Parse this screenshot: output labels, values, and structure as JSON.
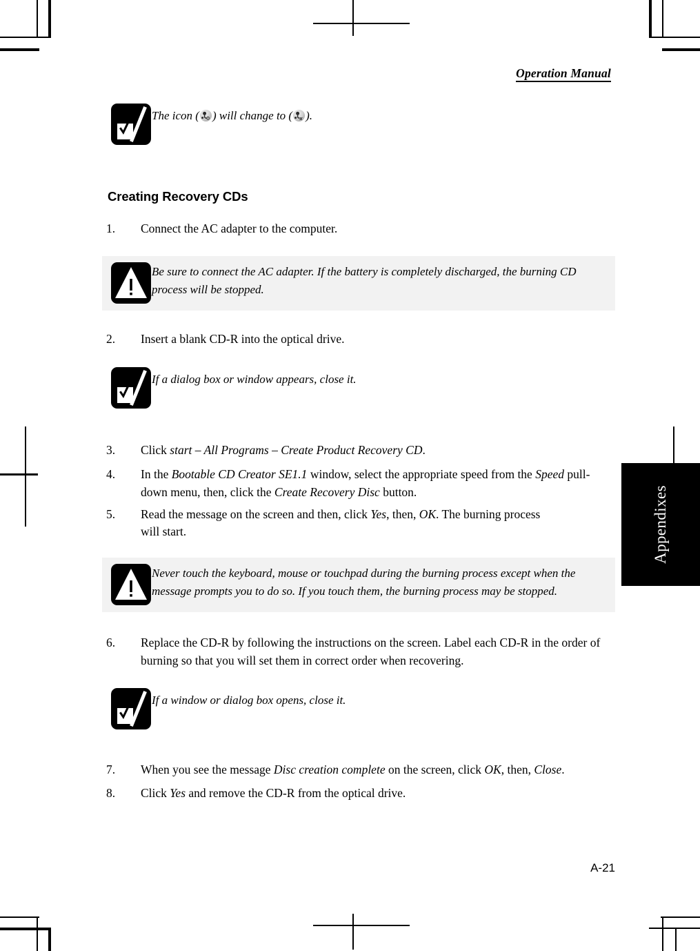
{
  "header": {
    "title": "Operation Manual"
  },
  "page_number": "A-21",
  "side_tab": {
    "label": "Appendixes"
  },
  "section": {
    "heading": "Creating Recovery CDs"
  },
  "top_note": {
    "icon": "note-check-icon",
    "text_before": "The icon (",
    "icon_1": "safely-remove-hardware-icon",
    "text_middle": ") will change to (",
    "icon_2": "safely-remove-hardware-stop-icon",
    "text_after": ")."
  },
  "steps": [
    {
      "num": "1.",
      "parts": [
        {
          "t": "Connect the AC adapter to the computer.",
          "i": false
        }
      ]
    },
    {
      "num": "2.",
      "parts": [
        {
          "t": "Insert a blank CD-R into the optical drive.",
          "i": false
        }
      ]
    },
    {
      "num": "3.",
      "parts": [
        {
          "t": "Click ",
          "i": false
        },
        {
          "t": "start – All Programs – Create Product Recovery CD",
          "i": true
        },
        {
          "t": ".",
          "i": false
        }
      ]
    },
    {
      "num": "4.",
      "parts": [
        {
          "t": "In the ",
          "i": false
        },
        {
          "t": "Bootable CD Creator SE1.1",
          "i": true
        },
        {
          "t": " window, select the appropriate speed from the ",
          "i": false
        },
        {
          "t": "Speed",
          "i": true
        },
        {
          "t": " pull-down menu, then, click the ",
          "i": false
        },
        {
          "t": "Create Recovery Disc",
          "i": true
        },
        {
          "t": " button.",
          "i": false
        }
      ]
    },
    {
      "num": "5.",
      "parts": [
        {
          "t": "Read the message on the screen and then, click ",
          "i": false
        },
        {
          "t": "Yes",
          "i": true
        },
        {
          "t": ", then, ",
          "i": false
        },
        {
          "t": "OK",
          "i": true
        },
        {
          "t": ". The burning process will start.",
          "i": false
        }
      ]
    },
    {
      "num": "6.",
      "parts": [
        {
          "t": "Replace the CD-R by following the instructions on the screen. Label each CD-R in the order of burning so that you will set them in correct order when recovering.",
          "i": false
        }
      ]
    },
    {
      "num": "7.",
      "parts": [
        {
          "t": "When you see the message ",
          "i": false
        },
        {
          "t": "Disc creation complete",
          "i": true
        },
        {
          "t": " on the screen, click ",
          "i": false
        },
        {
          "t": "OK",
          "i": true
        },
        {
          "t": ", then, ",
          "i": false
        },
        {
          "t": "Close",
          "i": true
        },
        {
          "t": ".",
          "i": false
        }
      ]
    },
    {
      "num": "8.",
      "parts": [
        {
          "t": "Click ",
          "i": false
        },
        {
          "t": "Yes",
          "i": true
        },
        {
          "t": " and remove the CD-R from the optical drive.",
          "i": false
        }
      ]
    }
  ],
  "callouts": {
    "warning_1": {
      "icon": "warning-triangle-icon",
      "text": "Be sure to connect the AC adapter. If the battery is completely discharged, the burning CD process will be stopped."
    },
    "note_2": {
      "icon": "note-check-icon",
      "text": "If a dialog box or window appears, close it."
    },
    "warning_2": {
      "icon": "warning-triangle-icon",
      "text": "Never touch the keyboard, mouse or touchpad during the burning process except when the message prompts you to do so. If you touch them, the burning process may be stopped."
    },
    "note_3": {
      "icon": "note-check-icon",
      "text": "If a window or dialog box opens, close it."
    }
  },
  "colors": {
    "callout_warning_bg": "#f2f2f2",
    "side_tab_bg": "#000000",
    "text": "#000000"
  }
}
